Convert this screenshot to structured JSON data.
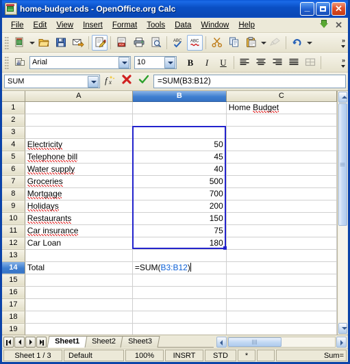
{
  "window": {
    "title_file": "home-budget.ods",
    "title_rest": " - OpenOffice.org Calc",
    "icon": "calc-document-icon",
    "minimize_label": "_",
    "maximize_label": "",
    "close_label": "✕"
  },
  "menubar": {
    "items": [
      {
        "label": "File",
        "accel": "F"
      },
      {
        "label": "Edit",
        "accel": "E"
      },
      {
        "label": "View",
        "accel": "V"
      },
      {
        "label": "Insert",
        "accel": "I"
      },
      {
        "label": "Format",
        "accel": "o"
      },
      {
        "label": "Tools",
        "accel": "T"
      },
      {
        "label": "Data",
        "accel": "D"
      },
      {
        "label": "Window",
        "accel": "W"
      },
      {
        "label": "Help",
        "accel": "H"
      }
    ],
    "doc_close_label": "✕"
  },
  "standard_toolbar": {
    "overflow_label": "»",
    "buttons": [
      {
        "name": "new-document",
        "title": "New"
      },
      {
        "name": "open-document",
        "title": "Open"
      },
      {
        "name": "save-document",
        "title": "Save"
      },
      {
        "name": "email-document",
        "title": "Document as E-mail"
      },
      {
        "name": "edit-file",
        "title": "Edit File",
        "active": true
      },
      {
        "name": "export-pdf",
        "title": "Export Directly as PDF"
      },
      {
        "name": "print-file",
        "title": "Print File Directly"
      },
      {
        "name": "print-preview",
        "title": "Page Preview"
      },
      {
        "name": "spelling",
        "title": "Spelling and Grammar"
      },
      {
        "name": "autospellcheck",
        "title": "AutoSpellcheck",
        "active": true
      },
      {
        "name": "cut",
        "title": "Cut"
      },
      {
        "name": "copy",
        "title": "Copy"
      },
      {
        "name": "paste",
        "title": "Paste"
      },
      {
        "name": "clone-formatting",
        "title": "Clone Formatting",
        "disabled": true
      },
      {
        "name": "undo",
        "title": "Undo"
      }
    ]
  },
  "formatting_toolbar": {
    "font_name": "Arial",
    "font_size": "10",
    "bold_label": "B",
    "italic_label": "I",
    "underline_label": "U",
    "overflow_label": "»",
    "styles_title": "Styles and Formatting",
    "align_left_title": "Align Left",
    "align_center_title": "Align Center Horizontally",
    "align_right_title": "Align Right",
    "align_justify_title": "Justified",
    "borders_title": "Borders"
  },
  "formula_bar": {
    "name_box_value": "SUM",
    "function_wizard_label": "fx",
    "cancel_label": "✖",
    "accept_label": "✔",
    "input_line_value": "=SUM(B3:B12)"
  },
  "sheet": {
    "columns": [
      {
        "label": "A",
        "selected": false
      },
      {
        "label": "B",
        "selected": true
      },
      {
        "label": "C",
        "selected": false
      }
    ],
    "rows": [
      {
        "num": "1",
        "active": false,
        "a": "",
        "b": "",
        "c": "Home Budget",
        "c_spell": true
      },
      {
        "num": "2",
        "active": false,
        "a": "",
        "b": "",
        "c": ""
      },
      {
        "num": "3",
        "active": false,
        "a": "",
        "b": "",
        "c": ""
      },
      {
        "num": "4",
        "active": false,
        "a": "Electricity",
        "a_spell": true,
        "b": "50",
        "c": ""
      },
      {
        "num": "5",
        "active": false,
        "a": "Telephone bill",
        "a_spell": true,
        "b": "45",
        "c": ""
      },
      {
        "num": "6",
        "active": false,
        "a": "Water supply",
        "a_spell": true,
        "b": "40",
        "c": ""
      },
      {
        "num": "7",
        "active": false,
        "a": "Groceries",
        "a_spell": true,
        "b": "500",
        "c": ""
      },
      {
        "num": "8",
        "active": false,
        "a": "Mortgage",
        "a_spell": true,
        "b": "700",
        "c": ""
      },
      {
        "num": "9",
        "active": false,
        "a": "Holidays",
        "a_spell": true,
        "b": "200",
        "c": ""
      },
      {
        "num": "10",
        "active": false,
        "a": "Restaurants",
        "a_spell": true,
        "b": "150",
        "c": ""
      },
      {
        "num": "11",
        "active": false,
        "a": "Car insurance",
        "a_spell": true,
        "b": "75",
        "c": ""
      },
      {
        "num": "12",
        "active": false,
        "a": "Car Loan",
        "a_spell": false,
        "b": "180",
        "c": ""
      },
      {
        "num": "13",
        "active": false,
        "a": "",
        "b": "",
        "c": ""
      },
      {
        "num": "14",
        "active": true,
        "a": "Total",
        "b": "",
        "c": "",
        "editing": true
      },
      {
        "num": "15",
        "active": false,
        "a": "",
        "b": "",
        "c": ""
      },
      {
        "num": "16",
        "active": false,
        "a": "",
        "b": "",
        "c": ""
      },
      {
        "num": "17",
        "active": false,
        "a": "",
        "b": "",
        "c": ""
      },
      {
        "num": "18",
        "active": false,
        "a": "",
        "b": "",
        "c": ""
      },
      {
        "num": "19",
        "active": false,
        "a": "",
        "b": "",
        "c": ""
      }
    ],
    "editing_cell": {
      "prefix": "=SUM(",
      "reference": "B3:B12",
      "suffix": ")"
    },
    "range_reference": "B3:B12",
    "reference_color": "#2222cc"
  },
  "tabbar": {
    "nav_first_title": "First Sheet",
    "nav_prev_title": "Previous Sheet",
    "nav_next_title": "Next Sheet",
    "nav_last_title": "Last Sheet",
    "tabs": [
      {
        "label": "Sheet1",
        "active": true
      },
      {
        "label": "Sheet2",
        "active": false
      },
      {
        "label": "Sheet3",
        "active": false
      }
    ]
  },
  "statusbar": {
    "sheet_position": "Sheet 1 / 3",
    "page_style": "Default",
    "zoom": "100%",
    "insert_mode": "INSRT",
    "selection_mode": "STD",
    "modified": "*",
    "signature": "",
    "sum_text": "Sum="
  }
}
